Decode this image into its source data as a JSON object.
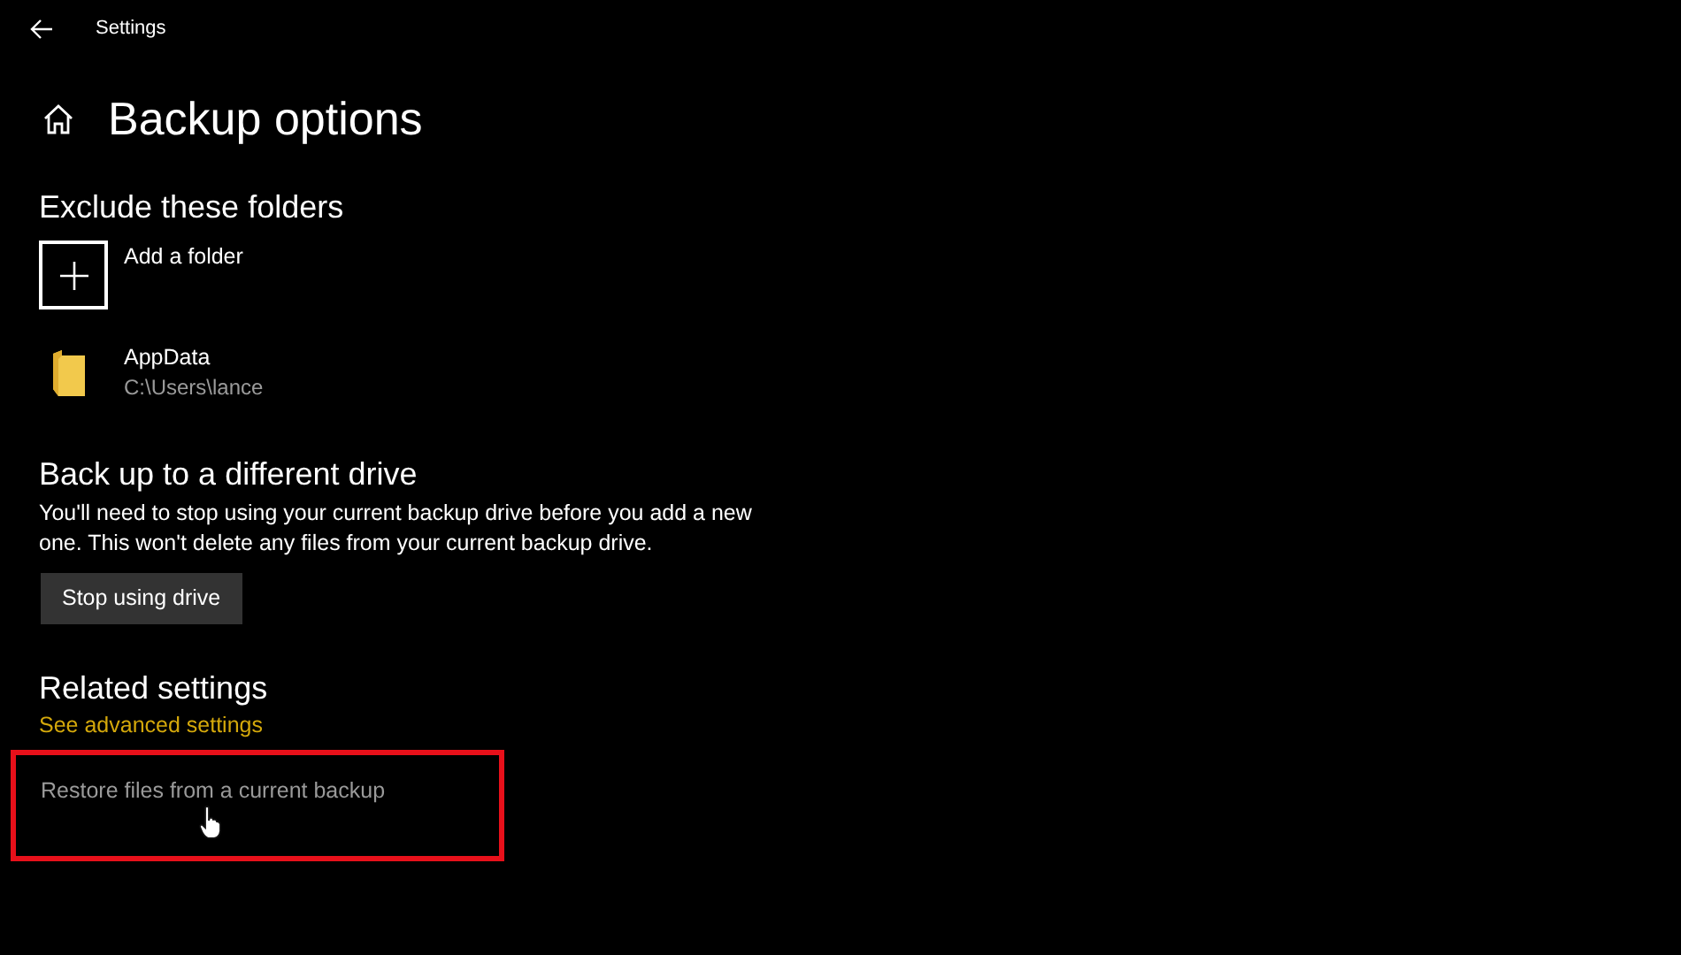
{
  "window": {
    "title": "Settings"
  },
  "page": {
    "title": "Backup options"
  },
  "exclude": {
    "heading": "Exclude these folders",
    "add_label": "Add a folder",
    "folders": [
      {
        "name": "AppData",
        "path": "C:\\Users\\lance"
      }
    ]
  },
  "drive": {
    "heading": "Back up to a different drive",
    "description": "You'll need to stop using your current backup drive before you add a new one. This won't delete any files from your current backup drive.",
    "button": "Stop using drive"
  },
  "related": {
    "heading": "Related settings",
    "links": [
      {
        "label": "See advanced settings",
        "highlighted": false,
        "kind": "accent"
      },
      {
        "label": "Restore files from a current backup",
        "highlighted": true,
        "kind": "muted"
      }
    ]
  }
}
